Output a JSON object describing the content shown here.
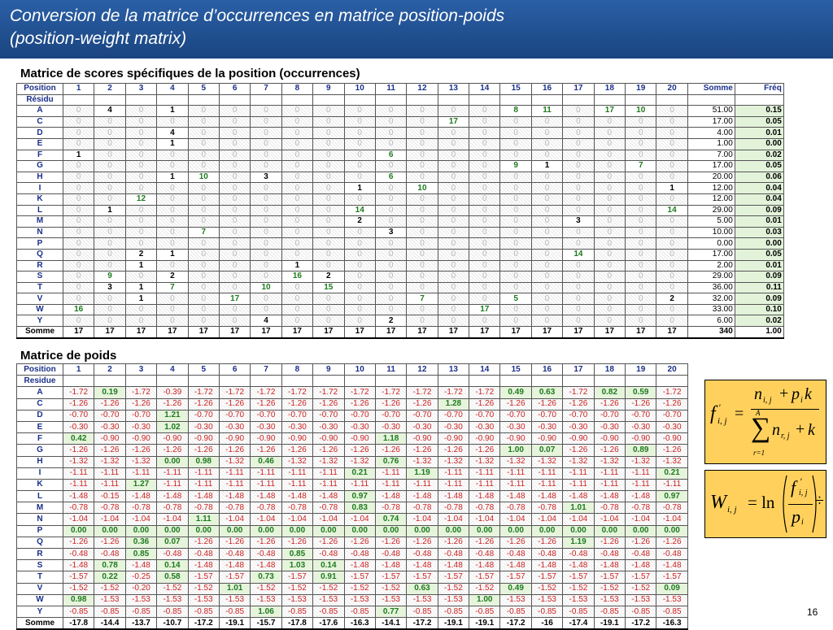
{
  "header": {
    "title_line1": "Conversion de la matrice d’occurrences en matrice position-poids",
    "title_line2": "(position-weight matrix)"
  },
  "occ": {
    "title": "Matrice de scores spécifiques de la position (occurrences)",
    "head_position": "Position",
    "head_residu": "Résidu",
    "head_somme": "Somme",
    "head_freq": "Fréq",
    "positions": [
      "1",
      "2",
      "3",
      "4",
      "5",
      "6",
      "7",
      "8",
      "9",
      "10",
      "11",
      "12",
      "13",
      "14",
      "15",
      "16",
      "17",
      "18",
      "19",
      "20"
    ],
    "rows": [
      {
        "res": "A",
        "vals": [
          0,
          4,
          0,
          1,
          0,
          0,
          0,
          0,
          0,
          0,
          0,
          0,
          0,
          0,
          8,
          11,
          0,
          17,
          10,
          0
        ],
        "sum": "51.00",
        "freq": "0.15"
      },
      {
        "res": "C",
        "vals": [
          0,
          0,
          0,
          0,
          0,
          0,
          0,
          0,
          0,
          0,
          0,
          0,
          17,
          0,
          0,
          0,
          0,
          0,
          0,
          0
        ],
        "sum": "17.00",
        "freq": "0.05"
      },
      {
        "res": "D",
        "vals": [
          0,
          0,
          0,
          4,
          0,
          0,
          0,
          0,
          0,
          0,
          0,
          0,
          0,
          0,
          0,
          0,
          0,
          0,
          0,
          0
        ],
        "sum": "4.00",
        "freq": "0.01"
      },
      {
        "res": "E",
        "vals": [
          0,
          0,
          0,
          1,
          0,
          0,
          0,
          0,
          0,
          0,
          0,
          0,
          0,
          0,
          0,
          0,
          0,
          0,
          0,
          0
        ],
        "sum": "1.00",
        "freq": "0.00"
      },
      {
        "res": "F",
        "vals": [
          1,
          0,
          0,
          0,
          0,
          0,
          0,
          0,
          0,
          0,
          6,
          0,
          0,
          0,
          0,
          0,
          0,
          0,
          0,
          0
        ],
        "sum": "7.00",
        "freq": "0.02"
      },
      {
        "res": "G",
        "vals": [
          0,
          0,
          0,
          0,
          0,
          0,
          0,
          0,
          0,
          0,
          0,
          0,
          0,
          0,
          9,
          1,
          0,
          0,
          7,
          0
        ],
        "sum": "17.00",
        "freq": "0.05"
      },
      {
        "res": "H",
        "vals": [
          0,
          0,
          0,
          1,
          10,
          0,
          3,
          0,
          0,
          0,
          6,
          0,
          0,
          0,
          0,
          0,
          0,
          0,
          0,
          0
        ],
        "sum": "20.00",
        "freq": "0.06"
      },
      {
        "res": "I",
        "vals": [
          0,
          0,
          0,
          0,
          0,
          0,
          0,
          0,
          0,
          1,
          0,
          10,
          0,
          0,
          0,
          0,
          0,
          0,
          0,
          1
        ],
        "sum": "12.00",
        "freq": "0.04"
      },
      {
        "res": "K",
        "vals": [
          0,
          0,
          12,
          0,
          0,
          0,
          0,
          0,
          0,
          0,
          0,
          0,
          0,
          0,
          0,
          0,
          0,
          0,
          0,
          0
        ],
        "sum": "12.00",
        "freq": "0.04"
      },
      {
        "res": "L",
        "vals": [
          0,
          1,
          0,
          0,
          0,
          0,
          0,
          0,
          0,
          14,
          0,
          0,
          0,
          0,
          0,
          0,
          0,
          0,
          0,
          14
        ],
        "sum": "29.00",
        "freq": "0.09"
      },
      {
        "res": "M",
        "vals": [
          0,
          0,
          0,
          0,
          0,
          0,
          0,
          0,
          0,
          2,
          0,
          0,
          0,
          0,
          0,
          0,
          3,
          0,
          0,
          0
        ],
        "sum": "5.00",
        "freq": "0.01"
      },
      {
        "res": "N",
        "vals": [
          0,
          0,
          0,
          0,
          7,
          0,
          0,
          0,
          0,
          0,
          3,
          0,
          0,
          0,
          0,
          0,
          0,
          0,
          0,
          0
        ],
        "sum": "10.00",
        "freq": "0.03"
      },
      {
        "res": "P",
        "vals": [
          0,
          0,
          0,
          0,
          0,
          0,
          0,
          0,
          0,
          0,
          0,
          0,
          0,
          0,
          0,
          0,
          0,
          0,
          0,
          0
        ],
        "sum": "0.00",
        "freq": "0.00"
      },
      {
        "res": "Q",
        "vals": [
          0,
          0,
          2,
          1,
          0,
          0,
          0,
          0,
          0,
          0,
          0,
          0,
          0,
          0,
          0,
          0,
          14,
          0,
          0,
          0
        ],
        "sum": "17.00",
        "freq": "0.05"
      },
      {
        "res": "R",
        "vals": [
          0,
          0,
          1,
          0,
          0,
          0,
          0,
          1,
          0,
          0,
          0,
          0,
          0,
          0,
          0,
          0,
          0,
          0,
          0,
          0
        ],
        "sum": "2.00",
        "freq": "0.01"
      },
      {
        "res": "S",
        "vals": [
          0,
          9,
          0,
          2,
          0,
          0,
          0,
          16,
          2,
          0,
          0,
          0,
          0,
          0,
          0,
          0,
          0,
          0,
          0,
          0
        ],
        "sum": "29.00",
        "freq": "0.09"
      },
      {
        "res": "T",
        "vals": [
          0,
          3,
          1,
          7,
          0,
          0,
          10,
          0,
          15,
          0,
          0,
          0,
          0,
          0,
          0,
          0,
          0,
          0,
          0,
          0
        ],
        "sum": "36.00",
        "freq": "0.11"
      },
      {
        "res": "V",
        "vals": [
          0,
          0,
          1,
          0,
          0,
          17,
          0,
          0,
          0,
          0,
          0,
          7,
          0,
          0,
          5,
          0,
          0,
          0,
          0,
          2
        ],
        "sum": "32.00",
        "freq": "0.09"
      },
      {
        "res": "W",
        "vals": [
          16,
          0,
          0,
          0,
          0,
          0,
          0,
          0,
          0,
          0,
          0,
          0,
          0,
          17,
          0,
          0,
          0,
          0,
          0,
          0
        ],
        "sum": "33.00",
        "freq": "0.10"
      },
      {
        "res": "Y",
        "vals": [
          0,
          0,
          0,
          0,
          0,
          0,
          4,
          0,
          0,
          0,
          2,
          0,
          0,
          0,
          0,
          0,
          0,
          0,
          0,
          0
        ],
        "sum": "6.00",
        "freq": "0.02"
      }
    ],
    "totals": {
      "label": "Somme",
      "vals": [
        "17",
        "17",
        "17",
        "17",
        "17",
        "17",
        "17",
        "17",
        "17",
        "17",
        "17",
        "17",
        "17",
        "17",
        "17",
        "17",
        "17",
        "17",
        "17",
        "17"
      ],
      "sum": "340",
      "freq": "1.00"
    }
  },
  "weights": {
    "title": "Matrice de poids",
    "head_position": "Position",
    "head_residue": "Residue",
    "rows": [
      {
        "res": "A",
        "vals": [
          "-1.72",
          "0.19",
          "-1.72",
          "-0.39",
          "-1.72",
          "-1.72",
          "-1.72",
          "-1.72",
          "-1.72",
          "-1.72",
          "-1.72",
          "-1.72",
          "-1.72",
          "-1.72",
          "0.49",
          "0.63",
          "-1.72",
          "0.82",
          "0.59",
          "-1.72"
        ]
      },
      {
        "res": "C",
        "vals": [
          "-1.26",
          "-1.26",
          "-1.26",
          "-1.26",
          "-1.26",
          "-1.26",
          "-1.26",
          "-1.26",
          "-1.26",
          "-1.26",
          "-1.26",
          "-1.26",
          "1.28",
          "-1.26",
          "-1.26",
          "-1.26",
          "-1.26",
          "-1.26",
          "-1.26",
          "-1.26"
        ]
      },
      {
        "res": "D",
        "vals": [
          "-0.70",
          "-0.70",
          "-0.70",
          "1.21",
          "-0.70",
          "-0.70",
          "-0.70",
          "-0.70",
          "-0.70",
          "-0.70",
          "-0.70",
          "-0.70",
          "-0.70",
          "-0.70",
          "-0.70",
          "-0.70",
          "-0.70",
          "-0.70",
          "-0.70",
          "-0.70"
        ]
      },
      {
        "res": "E",
        "vals": [
          "-0.30",
          "-0.30",
          "-0.30",
          "1.02",
          "-0.30",
          "-0.30",
          "-0.30",
          "-0.30",
          "-0.30",
          "-0.30",
          "-0.30",
          "-0.30",
          "-0.30",
          "-0.30",
          "-0.30",
          "-0.30",
          "-0.30",
          "-0.30",
          "-0.30",
          "-0.30"
        ]
      },
      {
        "res": "F",
        "vals": [
          "0.42",
          "-0.90",
          "-0.90",
          "-0.90",
          "-0.90",
          "-0.90",
          "-0.90",
          "-0.90",
          "-0.90",
          "-0.90",
          "1.18",
          "-0.90",
          "-0.90",
          "-0.90",
          "-0.90",
          "-0.90",
          "-0.90",
          "-0.90",
          "-0.90",
          "-0.90"
        ]
      },
      {
        "res": "G",
        "vals": [
          "-1.26",
          "-1.26",
          "-1.26",
          "-1.26",
          "-1.26",
          "-1.26",
          "-1.26",
          "-1.26",
          "-1.26",
          "-1.26",
          "-1.26",
          "-1.26",
          "-1.26",
          "-1.26",
          "1.00",
          "0.07",
          "-1.26",
          "-1.26",
          "0.89",
          "-1.26"
        ]
      },
      {
        "res": "H",
        "vals": [
          "-1.32",
          "-1.32",
          "-1.32",
          "0.00",
          "0.98",
          "-1.32",
          "0.46",
          "-1.32",
          "-1.32",
          "-1.32",
          "0.76",
          "-1.32",
          "-1.32",
          "-1.32",
          "-1.32",
          "-1.32",
          "-1.32",
          "-1.32",
          "-1.32",
          "-1.32"
        ]
      },
      {
        "res": "I",
        "vals": [
          "-1.11",
          "-1.11",
          "-1.11",
          "-1.11",
          "-1.11",
          "-1.11",
          "-1.11",
          "-1.11",
          "-1.11",
          "0.21",
          "-1.11",
          "1.19",
          "-1.11",
          "-1.11",
          "-1.11",
          "-1.11",
          "-1.11",
          "-1.11",
          "-1.11",
          "0.21"
        ]
      },
      {
        "res": "K",
        "vals": [
          "-1.11",
          "-1.11",
          "1.27",
          "-1.11",
          "-1.11",
          "-1.11",
          "-1.11",
          "-1.11",
          "-1.11",
          "-1.11",
          "-1.11",
          "-1.11",
          "-1.11",
          "-1.11",
          "-1.11",
          "-1.11",
          "-1.11",
          "-1.11",
          "-1.11",
          "-1.11"
        ]
      },
      {
        "res": "L",
        "vals": [
          "-1.48",
          "-0.15",
          "-1.48",
          "-1.48",
          "-1.48",
          "-1.48",
          "-1.48",
          "-1.48",
          "-1.48",
          "0.97",
          "-1.48",
          "-1.48",
          "-1.48",
          "-1.48",
          "-1.48",
          "-1.48",
          "-1.48",
          "-1.48",
          "-1.48",
          "0.97"
        ]
      },
      {
        "res": "M",
        "vals": [
          "-0.78",
          "-0.78",
          "-0.78",
          "-0.78",
          "-0.78",
          "-0.78",
          "-0.78",
          "-0.78",
          "-0.78",
          "0.83",
          "-0.78",
          "-0.78",
          "-0.78",
          "-0.78",
          "-0.78",
          "-0.78",
          "1.01",
          "-0.78",
          "-0.78",
          "-0.78"
        ]
      },
      {
        "res": "N",
        "vals": [
          "-1.04",
          "-1.04",
          "-1.04",
          "-1.04",
          "1.11",
          "-1.04",
          "-1.04",
          "-1.04",
          "-1.04",
          "-1.04",
          "0.74",
          "-1.04",
          "-1.04",
          "-1.04",
          "-1.04",
          "-1.04",
          "-1.04",
          "-1.04",
          "-1.04",
          "-1.04"
        ]
      },
      {
        "res": "P",
        "vals": [
          "0.00",
          "0.00",
          "0.00",
          "0.00",
          "0.00",
          "0.00",
          "0.00",
          "0.00",
          "0.00",
          "0.00",
          "0.00",
          "0.00",
          "0.00",
          "0.00",
          "0.00",
          "0.00",
          "0.00",
          "0.00",
          "0.00",
          "0.00"
        ]
      },
      {
        "res": "Q",
        "vals": [
          "-1.26",
          "-1.26",
          "0.36",
          "0.07",
          "-1.26",
          "-1.26",
          "-1.26",
          "-1.26",
          "-1.26",
          "-1.26",
          "-1.26",
          "-1.26",
          "-1.26",
          "-1.26",
          "-1.26",
          "-1.26",
          "1.19",
          "-1.26",
          "-1.26",
          "-1.26"
        ]
      },
      {
        "res": "R",
        "vals": [
          "-0.48",
          "-0.48",
          "0.85",
          "-0.48",
          "-0.48",
          "-0.48",
          "-0.48",
          "0.85",
          "-0.48",
          "-0.48",
          "-0.48",
          "-0.48",
          "-0.48",
          "-0.48",
          "-0.48",
          "-0.48",
          "-0.48",
          "-0.48",
          "-0.48",
          "-0.48"
        ]
      },
      {
        "res": "S",
        "vals": [
          "-1.48",
          "0.78",
          "-1.48",
          "0.14",
          "-1.48",
          "-1.48",
          "-1.48",
          "1.03",
          "0.14",
          "-1.48",
          "-1.48",
          "-1.48",
          "-1.48",
          "-1.48",
          "-1.48",
          "-1.48",
          "-1.48",
          "-1.48",
          "-1.48",
          "-1.48"
        ]
      },
      {
        "res": "T",
        "vals": [
          "-1.57",
          "0.22",
          "-0.25",
          "0.58",
          "-1.57",
          "-1.57",
          "0.73",
          "-1.57",
          "0.91",
          "-1.57",
          "-1.57",
          "-1.57",
          "-1.57",
          "-1.57",
          "-1.57",
          "-1.57",
          "-1.57",
          "-1.57",
          "-1.57",
          "-1.57"
        ]
      },
      {
        "res": "V",
        "vals": [
          "-1.52",
          "-1.52",
          "-0.20",
          "-1.52",
          "-1.52",
          "1.01",
          "-1.52",
          "-1.52",
          "-1.52",
          "-1.52",
          "-1.52",
          "0.63",
          "-1.52",
          "-1.52",
          "0.49",
          "-1.52",
          "-1.52",
          "-1.52",
          "-1.52",
          "0.09"
        ]
      },
      {
        "res": "W",
        "vals": [
          "0.98",
          "-1.53",
          "-1.53",
          "-1.53",
          "-1.53",
          "-1.53",
          "-1.53",
          "-1.53",
          "-1.53",
          "-1.53",
          "-1.53",
          "-1.53",
          "-1.53",
          "1.00",
          "-1.53",
          "-1.53",
          "-1.53",
          "-1.53",
          "-1.53",
          "-1.53"
        ]
      },
      {
        "res": "Y",
        "vals": [
          "-0.85",
          "-0.85",
          "-0.85",
          "-0.85",
          "-0.85",
          "-0.85",
          "1.06",
          "-0.85",
          "-0.85",
          "-0.85",
          "0.77",
          "-0.85",
          "-0.85",
          "-0.85",
          "-0.85",
          "-0.85",
          "-0.85",
          "-0.85",
          "-0.85",
          "-0.85"
        ]
      }
    ],
    "totals": {
      "label": "Somme",
      "vals": [
        "-17.8",
        "-14.4",
        "-13.7",
        "-10.7",
        "-17.2",
        "-19.1",
        "-15.7",
        "-17.8",
        "-17.6",
        "-16.3",
        "-14.1",
        "-17.2",
        "-19.1",
        "-19.1",
        "-17.2",
        "-16",
        "-17.4",
        "-19.1",
        "-17.2",
        "-16.3"
      ]
    }
  },
  "formula1": {
    "lhs_f": "f",
    "lhs_sub": "i, j",
    "lhs_prime": "'",
    "eq": "=",
    "num": "n",
    "num_sub": "i, j",
    "num_plus": "+",
    "num_p": "p",
    "num_p_sub": "i",
    "num_k": "k",
    "sum_top": "A",
    "sum_sym": "∑",
    "sum_bottom": "r=1",
    "den_n": "n",
    "den_sub": "r, j",
    "den_plus": "+",
    "den_k": "k"
  },
  "formula2": {
    "lhs_w": "W",
    "lhs_sub": "i, j",
    "eq": "= ln",
    "num_f": "f",
    "num_sub": "i, j",
    "num_prime": "'",
    "den_p": "p",
    "den_sub": "i",
    "tail": "÷"
  },
  "page_number": "16",
  "colors": {
    "header_bg": "#1f4e8c",
    "positive": "#1d7a1d",
    "negative": "#cc2222",
    "formula_bg": "#ffd15c"
  }
}
